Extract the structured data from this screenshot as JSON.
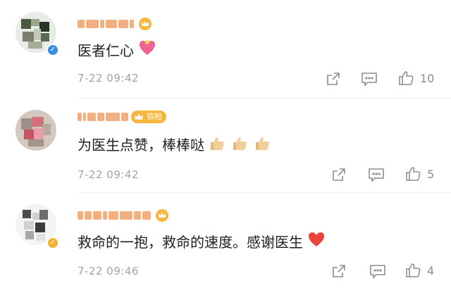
{
  "comments": [
    {
      "text": "医者仁心",
      "emoji": "heart-ribbon-icon",
      "time": "7-22 09:42",
      "like_count": "10",
      "verified": true,
      "fan_badge": ""
    },
    {
      "text": "为医生点赞，棒棒哒",
      "emoji": "thumbs-up-icon",
      "time": "7-22 09:42",
      "like_count": "5",
      "verified": false,
      "fan_badge": "铁粉"
    },
    {
      "text": "救命的一抱，救命的速度。感谢医生",
      "emoji": "red-heart-icon",
      "time": "7-22 09:46",
      "like_count": "4",
      "verified": true,
      "fan_badge": ""
    }
  ],
  "colors": {
    "name_blur": "#f0a26a",
    "badge_gold": "#f7b73f",
    "verified_blue": "#3b8de0",
    "meta_gray": "#a3a3a3",
    "heart_red": "#e8453c"
  }
}
